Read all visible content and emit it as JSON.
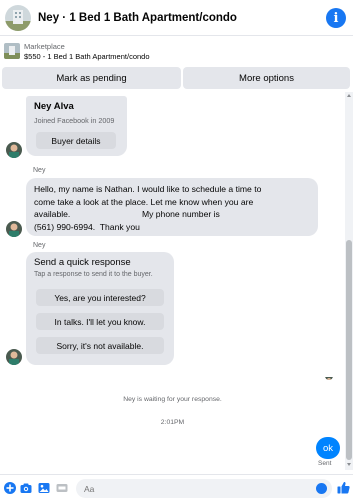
{
  "header": {
    "title": "Ney · 1 Bed 1 Bath Apartment/condo",
    "info_icon": "i"
  },
  "listing": {
    "label": "Marketplace",
    "detail": "$550 - 1 Bed 1 Bath Apartment/condo"
  },
  "actions": {
    "mark_pending": "Mark as pending",
    "more_options": "More options"
  },
  "profile_card": {
    "name": "Ney Alva",
    "joined": "Joined Facebook in 2009",
    "buyer_details": "Buyer details"
  },
  "messages": [
    {
      "sender": "Ney",
      "text": "Hello, my name is Nathan. I would like to schedule a time to\ncome take a look at the place. Let me know when you are\navailable.                              My phone number is\n(561) 990-6994.  Thank you"
    }
  ],
  "quick_response": {
    "sender": "Ney",
    "title": "Send a quick response",
    "subtitle": "Tap a response to send it to the buyer.",
    "options": [
      "Yes, are you interested?",
      "In talks. I'll let you know.",
      "Sorry, it's not available."
    ]
  },
  "status": {
    "waiting": "Ney is waiting for your response.",
    "time": "2:01PM",
    "my_message": "ok",
    "sent": "Sent"
  },
  "composer": {
    "placeholder": "Aa",
    "icons": [
      "plus-icon",
      "camera-icon",
      "photo-icon",
      "gif-icon",
      "emoji-icon",
      "thumbs-up-icon"
    ]
  },
  "colors": {
    "accent": "#1877f2",
    "my_bubble": "#0084ff",
    "bubble": "#e4e6eb",
    "secondary_text": "#65676b"
  }
}
